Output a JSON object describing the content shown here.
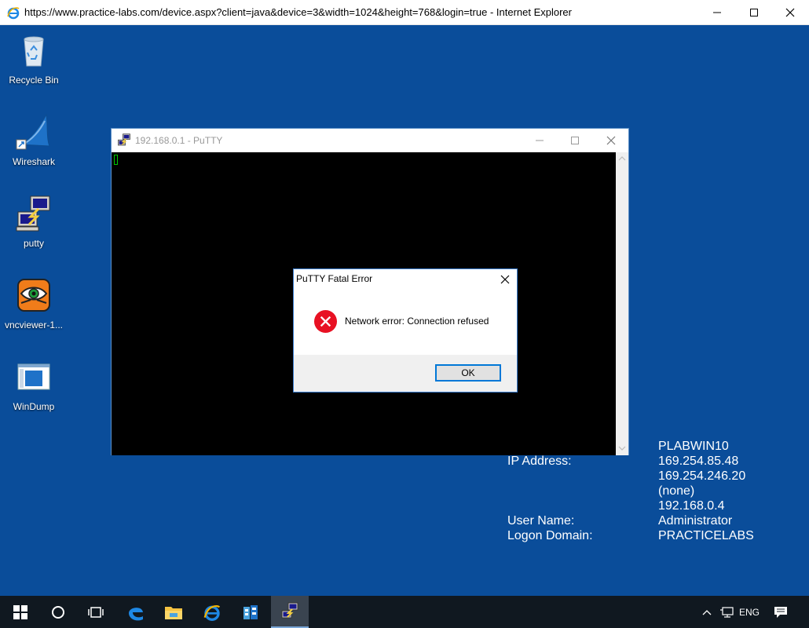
{
  "browser": {
    "title": "https://www.practice-labs.com/device.aspx?client=java&device=3&width=1024&height=768&login=true - Internet Explorer"
  },
  "desktop": {
    "icons": [
      {
        "label": "Recycle Bin",
        "icon": "recycle-bin-icon"
      },
      {
        "label": "Wireshark",
        "icon": "wireshark-icon"
      },
      {
        "label": "putty",
        "icon": "putty-icon"
      },
      {
        "label": "vncviewer-1...",
        "icon": "vncviewer-icon"
      },
      {
        "label": "WinDump",
        "icon": "windump-icon"
      }
    ]
  },
  "putty": {
    "title": "192.168.0.1 - PuTTY"
  },
  "dialog": {
    "title": "PuTTY Fatal Error",
    "message": "Network error: Connection refused",
    "ok_label": "OK"
  },
  "system_info": {
    "hostname": "PLABWIN10",
    "ip_label": "IP Address:",
    "ip_values": [
      "169.254.85.48",
      "169.254.246.20",
      "(none)",
      "192.168.0.4"
    ],
    "user_label": "User Name:",
    "user_value": "Administrator",
    "domain_label": "Logon Domain:",
    "domain_value": "PRACTICELABS"
  },
  "taskbar": {
    "language": "ENG"
  },
  "colors": {
    "desktop": "#0a4d9a",
    "taskbar": "#101820",
    "accent": "#0078d7",
    "error": "#e81123"
  }
}
